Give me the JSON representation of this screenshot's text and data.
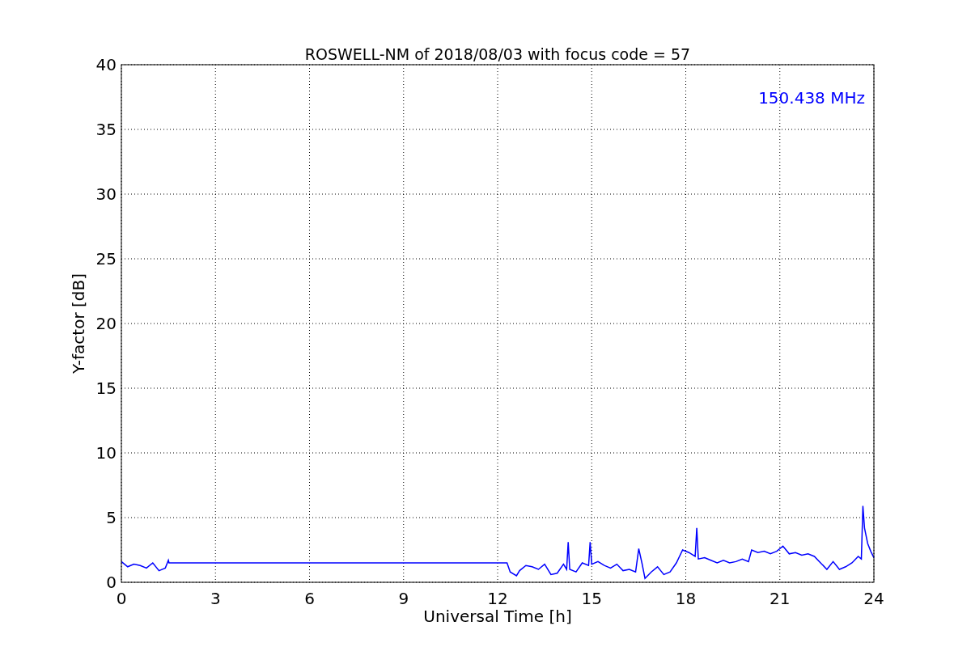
{
  "chart": {
    "chart_data": {
      "type": "line",
      "title": "ROSWELL-NM of 2018/08/03 with focus code = 57",
      "xlabel": "Universal Time [h]",
      "ylabel": "Y-factor [dB]",
      "x": [
        0,
        0.2,
        0.4,
        0.6,
        0.8,
        1.0,
        1.2,
        1.4,
        1.5,
        1.52,
        12.3,
        12.4,
        12.6,
        12.7,
        12.9,
        13.1,
        13.3,
        13.5,
        13.7,
        13.9,
        14.1,
        14.2,
        14.25,
        14.3,
        14.5,
        14.7,
        14.9,
        14.95,
        15.0,
        15.2,
        15.4,
        15.6,
        15.8,
        16.0,
        16.2,
        16.4,
        16.5,
        16.6,
        16.7,
        16.9,
        17.1,
        17.3,
        17.5,
        17.7,
        17.9,
        18.1,
        18.3,
        18.35,
        18.4,
        18.6,
        18.8,
        19.0,
        19.2,
        19.4,
        19.6,
        19.8,
        20.0,
        20.1,
        20.3,
        20.5,
        20.7,
        20.9,
        21.1,
        21.3,
        21.5,
        21.7,
        21.9,
        22.1,
        22.3,
        22.5,
        22.7,
        22.9,
        23.1,
        23.3,
        23.5,
        23.6,
        23.65,
        23.7,
        23.8,
        23.9,
        24
      ],
      "series": [
        {
          "name": "150.438 MHz",
          "color": "#0000ff",
          "values": [
            1.6,
            1.2,
            1.4,
            1.3,
            1.1,
            1.5,
            0.9,
            1.1,
            1.7,
            1.5,
            1.5,
            0.8,
            0.5,
            0.9,
            1.3,
            1.2,
            1.0,
            1.4,
            0.6,
            0.7,
            1.4,
            1.0,
            3.1,
            1.0,
            0.8,
            1.5,
            1.3,
            3.1,
            1.4,
            1.6,
            1.3,
            1.1,
            1.4,
            0.9,
            1.0,
            0.8,
            2.6,
            1.5,
            0.3,
            0.8,
            1.2,
            0.6,
            0.8,
            1.5,
            2.5,
            2.3,
            2.0,
            4.2,
            1.8,
            1.9,
            1.7,
            1.5,
            1.7,
            1.5,
            1.6,
            1.8,
            1.6,
            2.5,
            2.3,
            2.4,
            2.2,
            2.4,
            2.8,
            2.2,
            2.3,
            2.1,
            2.2,
            2.0,
            1.5,
            1.0,
            1.6,
            1.0,
            1.2,
            1.5,
            2.0,
            1.8,
            5.9,
            4.2,
            3.0,
            2.4,
            1.9
          ]
        }
      ],
      "xlim": [
        0,
        24
      ],
      "ylim": [
        0,
        40
      ],
      "xticks": [
        0,
        3,
        6,
        9,
        12,
        15,
        18,
        21,
        24
      ],
      "yticks": [
        0,
        5,
        10,
        15,
        20,
        25,
        30,
        35,
        40
      ],
      "grid": true
    }
  }
}
